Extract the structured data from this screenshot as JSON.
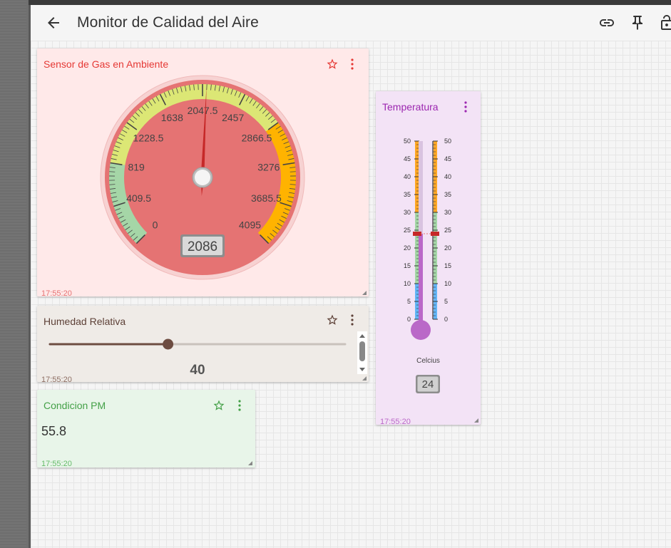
{
  "app": {
    "title": "Monitor de Calidad del Aire"
  },
  "gas": {
    "title": "Sensor de Gas en Ambiente",
    "timestamp": "17:55:20",
    "value": "2086",
    "value_num": 2086,
    "min": 0,
    "max": 4095,
    "ticks": [
      "0",
      "409.5",
      "819",
      "1228.5",
      "1638",
      "2047.5",
      "2457",
      "2866.5",
      "3276",
      "3685.5",
      "4095"
    ],
    "colors": {
      "face": "#e57373",
      "low": "#a5d6a7",
      "mid": "#dce775",
      "high": "#ffb300",
      "needle": "#c62828"
    }
  },
  "humidity": {
    "title": "Humedad Relativa",
    "timestamp": "17:55:20",
    "value": "40",
    "level": 0.4,
    "colors": {
      "thumb": "#6d4c41"
    }
  },
  "pm": {
    "title": "Condicion PM",
    "value": "55.8",
    "timestamp": "17:55:20",
    "colors": {
      "accent": "#43a047"
    }
  },
  "temperature": {
    "title": "Temperatura",
    "timestamp": "17:55:20",
    "unit": "Celcius",
    "value": "24",
    "value_num": 24,
    "min": 0,
    "max": 50,
    "ticks": [
      "0",
      "5",
      "10",
      "15",
      "20",
      "25",
      "30",
      "35",
      "40",
      "45",
      "50"
    ],
    "colors": {
      "accent": "#9c27b0",
      "mercury": "#ba68c8",
      "cold": "#64b5f6",
      "normal": "#a5d6a7",
      "hot": "#ffa726"
    }
  }
}
